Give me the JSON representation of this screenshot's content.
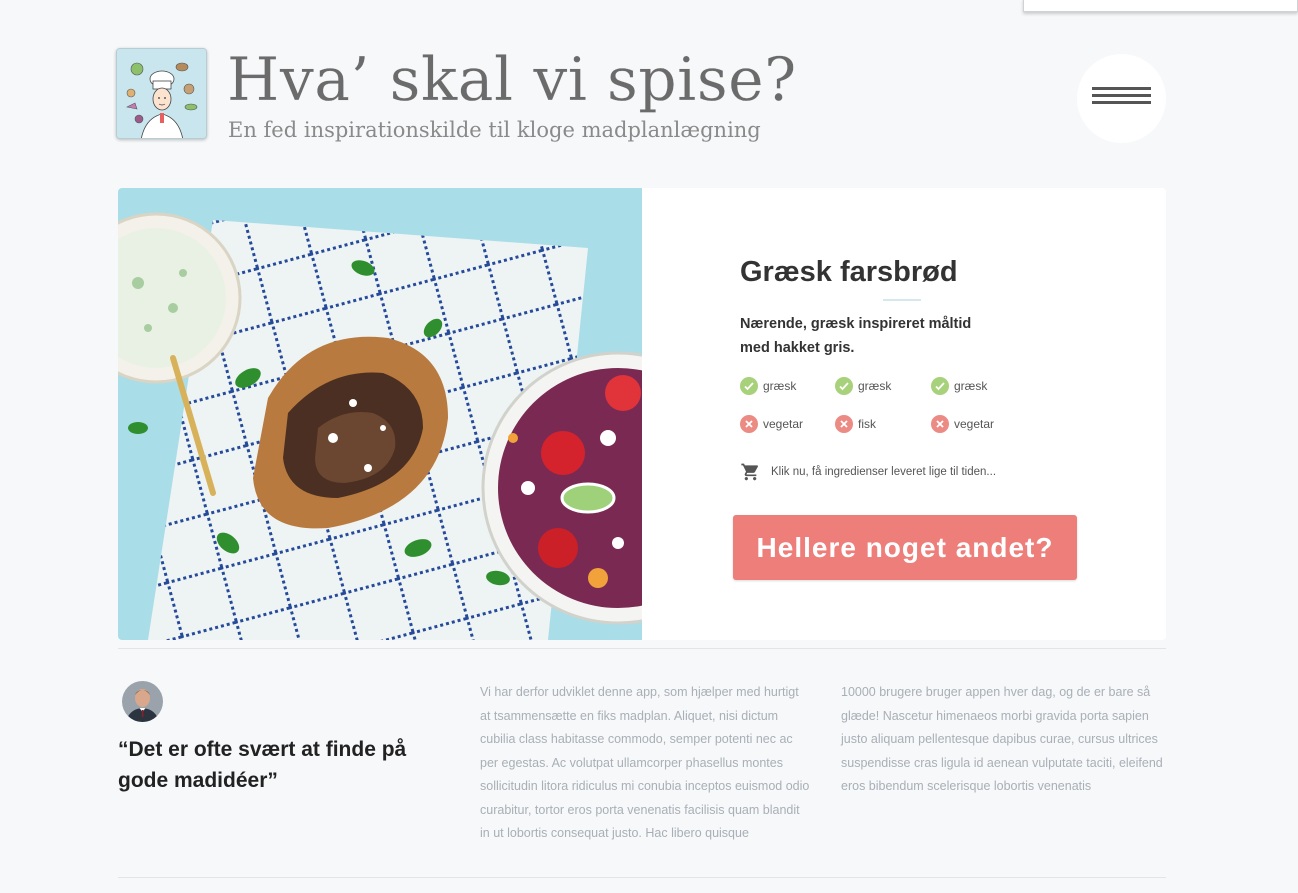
{
  "header": {
    "title": "Hva’ skal vi spise?",
    "subtitle": "En fed inspirationskilde til kloge madplanlægning",
    "logo_icon": "chef-logo-icon",
    "menu_icon": "hamburger-menu-icon"
  },
  "recipe": {
    "title": "Græsk farsbrød",
    "description": "Nærende, græsk inspireret måltid med hakket gris.",
    "tags_yes": [
      {
        "label": "græsk",
        "icon": "check-icon"
      },
      {
        "label": "græsk",
        "icon": "check-icon"
      },
      {
        "label": "græsk",
        "icon": "check-icon"
      }
    ],
    "tags_no": [
      {
        "label": "vegetar",
        "icon": "cross-icon"
      },
      {
        "label": "fisk",
        "icon": "cross-icon"
      },
      {
        "label": "vegetar",
        "icon": "cross-icon"
      }
    ],
    "cart_icon": "shopping-cart-icon",
    "cart_text": "Klik nu, få ingredienser leveret lige til tiden...",
    "cta_label": "Hellere noget andet?"
  },
  "testimonial": {
    "quote": "“Det er ofte svært at finde på gode madidéer”",
    "avatar_icon": "user-avatar"
  },
  "info": {
    "col1": "Vi har derfor udviklet denne app, som hjælper med hurtigt at tsammensætte en fiks madplan. Aliquet, nisi dictum cubilia class habitasse commodo, semper potenti nec ac per egestas. Ac volutpat ullamcorper phasellus montes sollicitudin litora ridiculus mi conubia inceptos euismod odio curabitur, tortor eros porta venenatis facilisis quam blandit in ut lobortis consequat justo. Hac libero quisque",
    "col2": "10000 brugere bruger appen hver dag, og de er bare så glæde! Nascetur himenaeos morbi gravida porta sapien justo aliquam pellentesque dapibus curae, cursus ultrices suspendisse cras ligula id aenean vulputate taciti, eleifend eros bibendum scelerisque lobortis venenatis"
  },
  "colors": {
    "background": "#f6f8fa",
    "accent": "#ee7e7a",
    "check": "#a7d17a",
    "cross": "#ec8a84",
    "logo_bg": "#c9e6ee"
  }
}
